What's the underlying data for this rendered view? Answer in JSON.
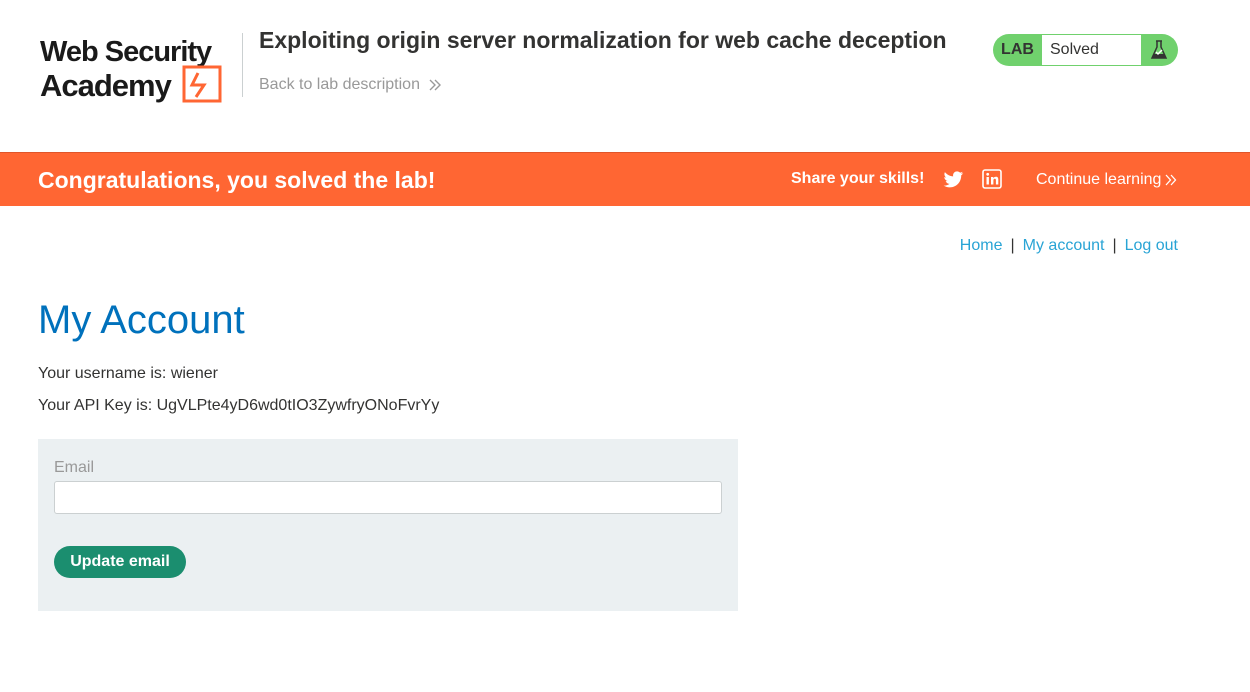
{
  "header": {
    "logo_line1": "Web Security",
    "logo_line2": "Academy",
    "lab_title": "Exploiting origin server normalization for web cache deception",
    "back_link": "Back to lab description",
    "lab_badge": "LAB",
    "lab_state": "Solved"
  },
  "banner": {
    "message": "Congratulations, you solved the lab!",
    "share_label": "Share your skills!",
    "continue_label": "Continue learning"
  },
  "nav": {
    "home": "Home",
    "sep1": "|",
    "my_account": "My account",
    "sep2": "|",
    "logout": "Log out"
  },
  "main": {
    "title": "My Account",
    "username_line": "Your username is: wiener",
    "api_key_line": "Your API Key is: UgVLPte4yD6wd0tIO3ZywfryONoFvrYy",
    "email_label": "Email",
    "email_value": "",
    "update_button": "Update email"
  },
  "colors": {
    "banner": "#ff6633",
    "lab_status": "#70d16d",
    "title": "#0071bc",
    "link": "#29a4d5",
    "button": "#1b8e6f",
    "form_bg": "#ebf0f2"
  }
}
